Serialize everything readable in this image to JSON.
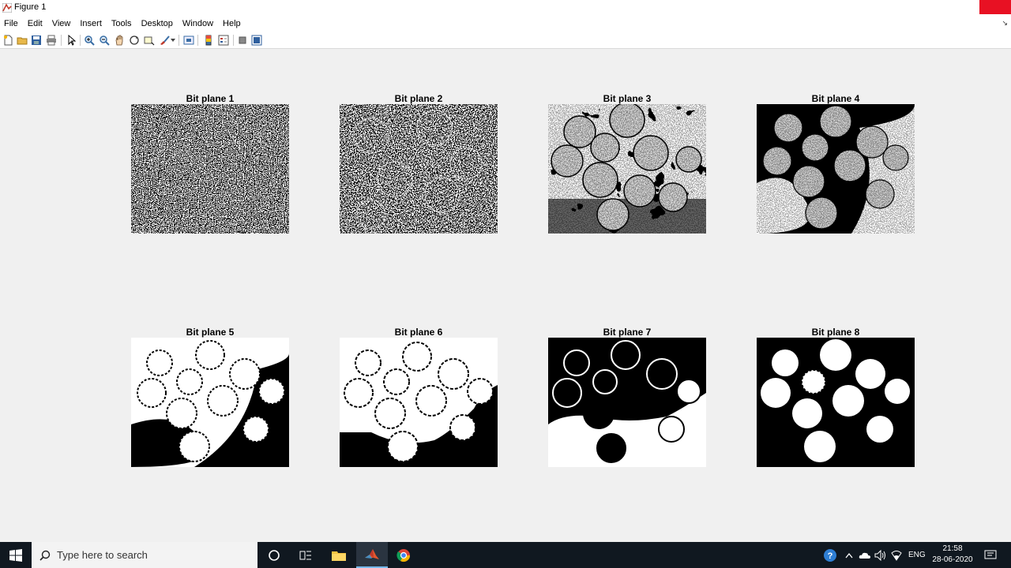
{
  "window": {
    "title": "Figure 1",
    "close_color": "#e81123"
  },
  "menubar": {
    "items": [
      "File",
      "Edit",
      "View",
      "Insert",
      "Tools",
      "Desktop",
      "Window",
      "Help"
    ]
  },
  "toolbar": {
    "buttons": [
      "new-figure-icon",
      "open-file-icon",
      "save-icon",
      "print-icon",
      "pointer-icon",
      "zoom-in-icon",
      "zoom-out-icon",
      "pan-icon",
      "rotate-3d-icon",
      "data-cursor-icon",
      "brush-icon",
      "link-plot-icon",
      "colorbar-icon",
      "legend-icon",
      "hide-plot-tools-icon",
      "show-plot-tools-icon"
    ]
  },
  "subplots": [
    {
      "title": "Bit plane 1",
      "pattern": "noise"
    },
    {
      "title": "Bit plane 2",
      "pattern": "noise-faint-coins"
    },
    {
      "title": "Bit plane 3",
      "pattern": "textured-coins"
    },
    {
      "title": "Bit plane 4",
      "pattern": "textured-coins-dark-bg"
    },
    {
      "title": "Bit plane 5",
      "pattern": "outlined-coins-white-top"
    },
    {
      "title": "Bit plane 6",
      "pattern": "outlined-coins-white-top"
    },
    {
      "title": "Bit plane 7",
      "pattern": "dark-coins-split-bg"
    },
    {
      "title": "Bit plane 8",
      "pattern": "solid-white-coins"
    }
  ],
  "taskbar": {
    "search_placeholder": "Type here to search",
    "language": "ENG",
    "time": "21:58",
    "date": "28-06-2020",
    "apps": [
      "cortana-icon",
      "task-view-icon",
      "file-explorer-icon",
      "matlab-icon",
      "chrome-icon"
    ]
  }
}
